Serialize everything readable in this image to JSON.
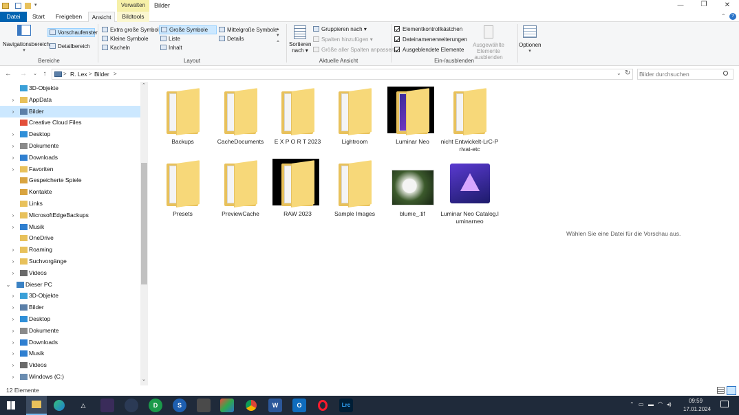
{
  "titlebar": {
    "context_tab": "Verwalten",
    "title": "Bilder",
    "minimize": "—",
    "maximize": "❐",
    "close": "✕"
  },
  "tabs": {
    "datei": "Datei",
    "start": "Start",
    "freigeben": "Freigeben",
    "ansicht": "Ansicht",
    "bildtools": "Bildtools"
  },
  "ribbon": {
    "bereiche": {
      "navigationsbereich": "Navigationsbereich",
      "vorschaufenster": "Vorschaufenster",
      "detailbereich": "Detailbereich",
      "label": "Bereiche"
    },
    "layout": {
      "extra_grosse": "Extra große Symbole",
      "grosse": "Große Symbole",
      "mittelgrosse": "Mittelgroße Symbole",
      "kleine": "Kleine Symbole",
      "liste": "Liste",
      "details": "Details",
      "kacheln": "Kacheln",
      "inhalt": "Inhalt",
      "label": "Layout"
    },
    "aktuelle_ansicht": {
      "sortieren": "Sortieren",
      "nach": "nach",
      "gruppieren": "Gruppieren nach",
      "spalten_hinzufuegen": "Spalten hinzufügen",
      "groesse_spalten": "Größe aller Spalten anpassen",
      "label": "Aktuelle Ansicht"
    },
    "ein_ausblenden": {
      "elementkontrollkaestchen": "Elementkontrollkästchen",
      "dateinamenerweiterungen": "Dateinamenerweiterungen",
      "ausgeblendete_elemente": "Ausgeblendete Elemente",
      "ausgewaehlte_1": "Ausgewählte",
      "ausgewaehlte_2": "Elemente ausblenden",
      "label": "Ein-/ausblenden"
    },
    "optionen": "Optionen"
  },
  "address": {
    "crumb_1": "R. Lex",
    "crumb_2": "Bilder",
    "separator": ">",
    "search_placeholder": "Bilder durchsuchen"
  },
  "nav_items": [
    {
      "label": "3D-Objekte",
      "chev": "",
      "color": "#3aa0d8"
    },
    {
      "label": "AppData",
      "chev": "›",
      "color": "#e8c15b"
    },
    {
      "label": "Bilder",
      "chev": "›",
      "color": "#5b7fa8"
    },
    {
      "label": "Creative Cloud Files",
      "chev": "",
      "color": "#e34f3a"
    },
    {
      "label": "Desktop",
      "chev": "›",
      "color": "#2f8fd8"
    },
    {
      "label": "Dokumente",
      "chev": "›",
      "color": "#8a8a8a"
    },
    {
      "label": "Downloads",
      "chev": "›",
      "color": "#2f7fd0"
    },
    {
      "label": "Favoriten",
      "chev": "›",
      "color": "#e8c15b"
    },
    {
      "label": "Gespeicherte Spiele",
      "chev": "",
      "color": "#d9a440"
    },
    {
      "label": "Kontakte",
      "chev": "",
      "color": "#d9a440"
    },
    {
      "label": "Links",
      "chev": "",
      "color": "#e8c15b"
    },
    {
      "label": "MicrosoftEdgeBackups",
      "chev": "›",
      "color": "#e8c15b"
    },
    {
      "label": "Musik",
      "chev": "›",
      "color": "#2f7fd0"
    },
    {
      "label": "OneDrive",
      "chev": "",
      "color": "#e8c15b"
    },
    {
      "label": "Roaming",
      "chev": "›",
      "color": "#e8c15b"
    },
    {
      "label": "Suchvorgänge",
      "chev": "›",
      "color": "#e8c15b"
    },
    {
      "label": "Videos",
      "chev": "›",
      "color": "#6a6a6a"
    },
    {
      "label": "Dieser PC",
      "chev": "⌄",
      "color": "#3b82c4"
    },
    {
      "label": "3D-Objekte",
      "chev": "›",
      "color": "#3aa0d8"
    },
    {
      "label": "Bilder",
      "chev": "›",
      "color": "#5b7fa8"
    },
    {
      "label": "Desktop",
      "chev": "›",
      "color": "#2f8fd8"
    },
    {
      "label": "Dokumente",
      "chev": "›",
      "color": "#8a8a8a"
    },
    {
      "label": "Downloads",
      "chev": "›",
      "color": "#2f7fd0"
    },
    {
      "label": "Musik",
      "chev": "›",
      "color": "#2f7fd0"
    },
    {
      "label": "Videos",
      "chev": "›",
      "color": "#6a6a6a"
    },
    {
      "label": "Windows (C:)",
      "chev": "›",
      "color": "#6a8cb0"
    }
  ],
  "files": [
    {
      "label": "Backups",
      "kind": "folder"
    },
    {
      "label": "CacheDocuments",
      "kind": "folder"
    },
    {
      "label": "E X P O R T 2023",
      "kind": "folder"
    },
    {
      "label": "Lightroom",
      "kind": "folder"
    },
    {
      "label": "Luminar Neo",
      "kind": "folder-thumb"
    },
    {
      "label": "nicht Entwickelt-LrC-Privat-etc",
      "kind": "folder"
    },
    {
      "label": "Presets",
      "kind": "folder"
    },
    {
      "label": "PreviewCache",
      "kind": "folder"
    },
    {
      "label": "RAW 2023",
      "kind": "folder-thumb"
    },
    {
      "label": "Sample Images",
      "kind": "folder"
    },
    {
      "label": "blume_.tif",
      "kind": "image"
    },
    {
      "label": "Luminar Neo Catalog.luminarneo",
      "kind": "app"
    }
  ],
  "preview_text": "Wählen Sie eine Datei für die Vorschau aus.",
  "status": {
    "count": "12 Elemente"
  },
  "taskbar": {
    "time": "09:59",
    "date": "17.01.2024",
    "lrc": "Lrc"
  },
  "colors": {
    "accent": "#0063b1",
    "selection": "#cce8ff",
    "context_tab": "#f6f0a8",
    "taskbar": "#1f2a3a"
  }
}
